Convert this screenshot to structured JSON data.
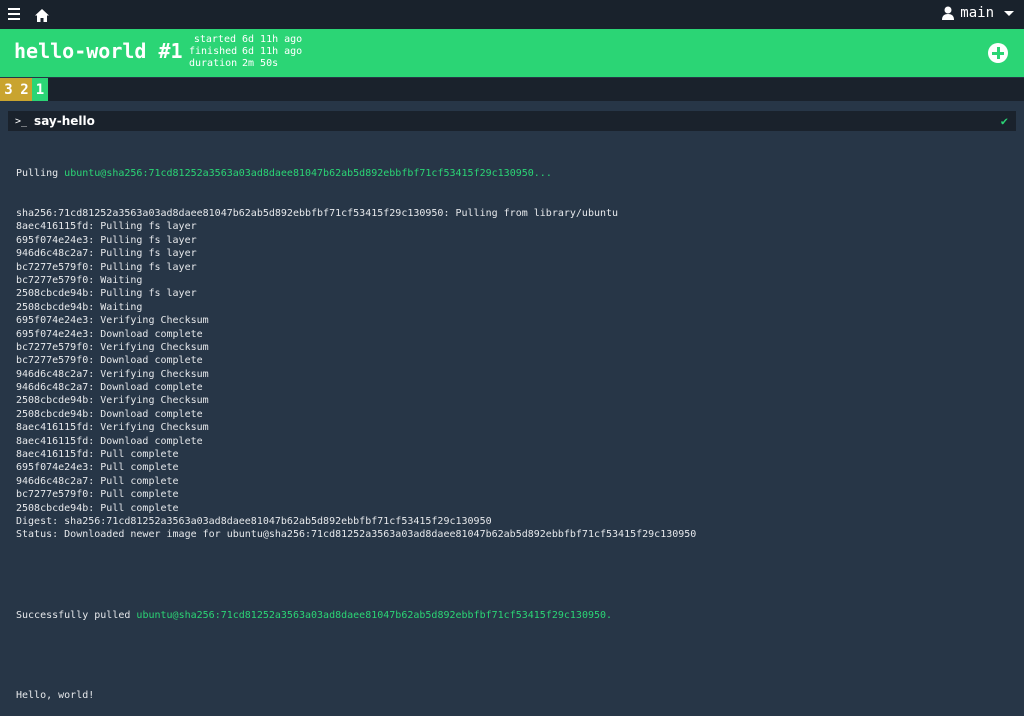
{
  "topbar": {
    "user_label": "main"
  },
  "build": {
    "title": "hello-world #1",
    "times": [
      {
        "label": "started",
        "value": "6d 11h ago"
      },
      {
        "label": "finished",
        "value": "6d 11h ago"
      },
      {
        "label": "duration",
        "value": "2m 50s"
      }
    ]
  },
  "builds": [
    "3",
    "2",
    "1"
  ],
  "step": {
    "prompt": ">_",
    "name": "say-hello",
    "status_icon": "check-icon"
  },
  "log": {
    "pull_prefix": "Pulling ",
    "pull_image": "ubuntu@sha256:71cd81252a3563a03ad8daee81047b62ab5d892ebbfbf71cf53415f29c130950...",
    "lines": [
      "sha256:71cd81252a3563a03ad8daee81047b62ab5d892ebbfbf71cf53415f29c130950: Pulling from library/ubuntu",
      "8aec416115fd: Pulling fs layer",
      "695f074e24e3: Pulling fs layer",
      "946d6c48c2a7: Pulling fs layer",
      "bc7277e579f0: Pulling fs layer",
      "bc7277e579f0: Waiting",
      "2508cbcde94b: Pulling fs layer",
      "2508cbcde94b: Waiting",
      "695f074e24e3: Verifying Checksum",
      "695f074e24e3: Download complete",
      "bc7277e579f0: Verifying Checksum",
      "bc7277e579f0: Download complete",
      "946d6c48c2a7: Verifying Checksum",
      "946d6c48c2a7: Download complete",
      "2508cbcde94b: Verifying Checksum",
      "2508cbcde94b: Download complete",
      "8aec416115fd: Verifying Checksum",
      "8aec416115fd: Download complete",
      "8aec416115fd: Pull complete",
      "695f074e24e3: Pull complete",
      "946d6c48c2a7: Pull complete",
      "bc7277e579f0: Pull complete",
      "2508cbcde94b: Pull complete",
      "Digest: sha256:71cd81252a3563a03ad8daee81047b62ab5d892ebbfbf71cf53415f29c130950",
      "Status: Downloaded newer image for ubuntu@sha256:71cd81252a3563a03ad8daee81047b62ab5d892ebbfbf71cf53415f29c130950"
    ],
    "success_prefix": "Successfully pulled ",
    "success_image": "ubuntu@sha256:71cd81252a3563a03ad8daee81047b62ab5d892ebbfbf71cf53415f29c130950.",
    "output": "Hello, world!"
  },
  "colors": {
    "succeeded": "#2bd575",
    "pending": "#c9a42f",
    "background": "#273647",
    "topbar": "#19222c"
  }
}
